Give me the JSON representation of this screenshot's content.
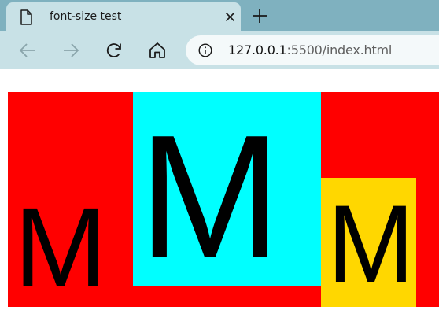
{
  "browser": {
    "tab": {
      "title": "font-size test",
      "icon": "file-icon",
      "close_icon": "close-icon"
    },
    "new_tab_icon": "plus-icon",
    "toolbar": {
      "back_icon": "arrow-left-icon",
      "forward_icon": "arrow-right-icon",
      "refresh_icon": "refresh-icon",
      "home_icon": "home-icon"
    },
    "address_bar": {
      "info_icon": "info-icon",
      "url_host": "127.0.0.1",
      "url_rest": ":5500/index.html"
    }
  },
  "page": {
    "boxes": [
      {
        "letter": "M",
        "background": "#ff0000"
      },
      {
        "letter": "M",
        "background": "#00ffff"
      },
      {
        "letter": "M",
        "background": "#ffd700"
      }
    ]
  }
}
